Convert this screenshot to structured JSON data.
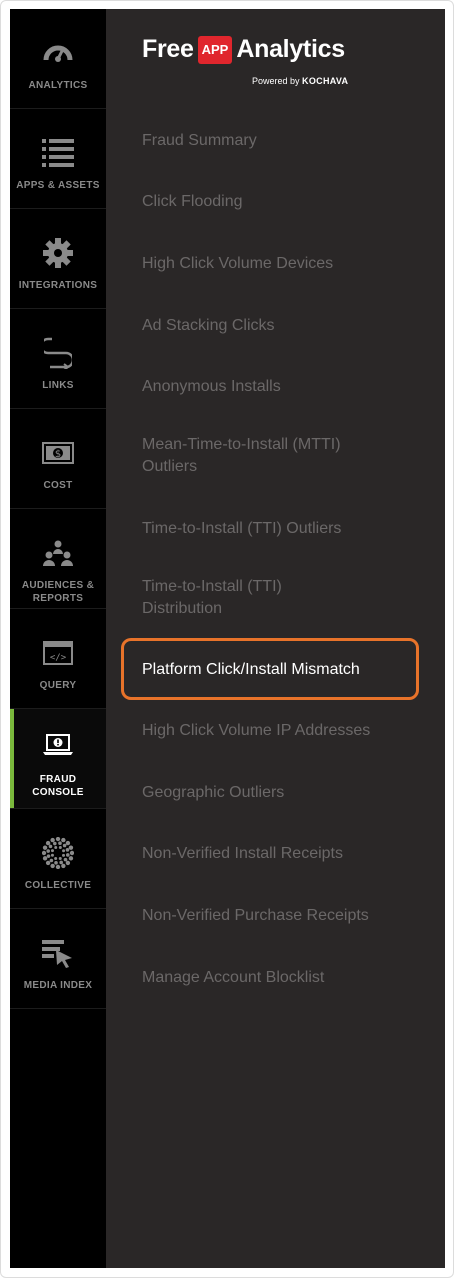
{
  "brand": {
    "free": "Free",
    "badge": "APP",
    "analytics": "Analytics",
    "powered_prefix": "Powered by",
    "powered_brand": "KOCHAVA"
  },
  "rail": {
    "items": [
      {
        "label": "ANALYTICS",
        "icon": "dashboard-gauge-icon"
      },
      {
        "label": "APPS & ASSETS",
        "icon": "list-icon"
      },
      {
        "label": "INTEGRATIONS",
        "icon": "gear-icon"
      },
      {
        "label": "LINKS",
        "icon": "link-path-icon"
      },
      {
        "label": "COST",
        "icon": "dollar-bill-icon"
      },
      {
        "label": "AUDIENCES & REPORTS",
        "icon": "audience-people-icon"
      },
      {
        "label": "QUERY",
        "icon": "code-window-icon"
      },
      {
        "label": "FRAUD CONSOLE",
        "icon": "laptop-alert-icon",
        "active": true
      },
      {
        "label": "COLLECTIVE",
        "icon": "collective-dots-icon"
      },
      {
        "label": "MEDIA INDEX",
        "icon": "media-index-cursor-icon"
      }
    ]
  },
  "menu": {
    "items": [
      "Fraud Summary",
      "Click Flooding",
      "High Click Volume Devices",
      "Ad Stacking Clicks",
      "Anonymous Installs",
      "Mean-Time-to-Install (MTTI) Outliers",
      "Time-to-Install (TTI) Outliers",
      "Time-to-Install (TTI) Distribution",
      "Platform Click/Install Mismatch",
      "High Click Volume IP Addresses",
      "Geographic Outliers",
      "Non-Verified Install Receipts",
      "Non-Verified Purchase Receipts",
      "Manage Account Blocklist"
    ],
    "selected": "Platform Click/Install Mismatch"
  },
  "colors": {
    "rail_bg": "#000000",
    "panel_bg": "#2a2727",
    "active_indicator": "#7ab83c",
    "highlight_border": "#e8732a",
    "badge_red": "#e0262d",
    "menu_text": "#6b6868",
    "menu_text_selected": "#ffffff"
  }
}
